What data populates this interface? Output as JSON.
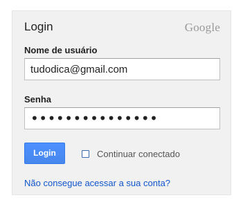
{
  "header": {
    "title": "Login",
    "logo_text": "Google"
  },
  "form": {
    "username": {
      "label": "Nome de usuário",
      "value": "tudodica@gmail.com"
    },
    "password": {
      "label": "Senha",
      "masked_value": "•••••••••••••••"
    },
    "login_button": "Login",
    "remember": {
      "label": "Continuar conectado",
      "checked": false
    },
    "help_link": "Não consegue acessar a sua conta?"
  },
  "colors": {
    "panel_bg": "#f1f1f1",
    "button_blue": "#4d90fe",
    "link": "#1155cc",
    "logo_gray": "#999999"
  }
}
